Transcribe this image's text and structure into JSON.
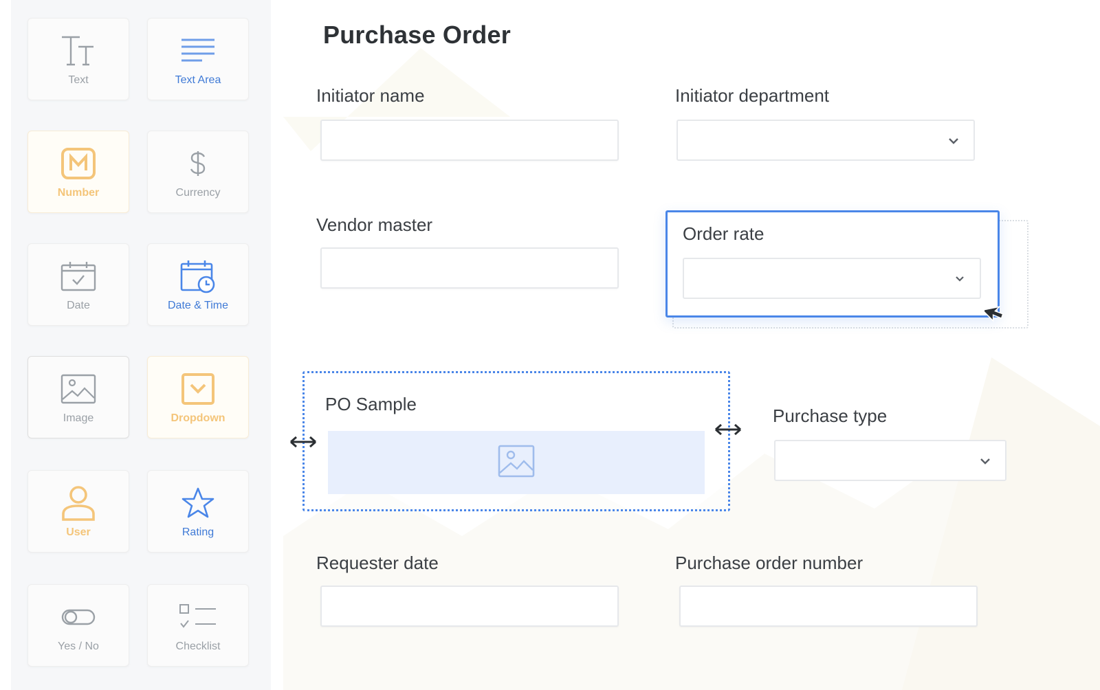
{
  "sidebar": {
    "items": [
      {
        "label": "Text",
        "icon": "text-type-icon"
      },
      {
        "label": "Text Area",
        "icon": "text-area-icon"
      },
      {
        "label": "Number",
        "icon": "number-icon"
      },
      {
        "label": "Currency",
        "icon": "dollar-icon"
      },
      {
        "label": "Date",
        "icon": "calendar-check-icon"
      },
      {
        "label": "Date & Time",
        "icon": "calendar-clock-icon"
      },
      {
        "label": "Image",
        "icon": "image-icon"
      },
      {
        "label": "Dropdown",
        "icon": "dropdown-icon"
      },
      {
        "label": "User",
        "icon": "user-icon"
      },
      {
        "label": "Rating",
        "icon": "star-icon"
      },
      {
        "label": "Yes / No",
        "icon": "toggle-icon"
      },
      {
        "label": "Checklist",
        "icon": "checklist-icon"
      }
    ]
  },
  "form": {
    "title": "Purchase Order",
    "fields": {
      "initiator_name": {
        "label": "Initiator name",
        "value": ""
      },
      "initiator_department": {
        "label": "Initiator department",
        "value": ""
      },
      "vendor_master": {
        "label": "Vendor master",
        "value": ""
      },
      "order_rate": {
        "label": "Order rate",
        "value": ""
      },
      "po_sample": {
        "label": "PO Sample"
      },
      "purchase_type": {
        "label": "Purchase type",
        "value": ""
      },
      "requester_date": {
        "label": "Requester date",
        "value": ""
      },
      "purchase_order_number": {
        "label": "Purchase order number",
        "value": ""
      }
    }
  },
  "colors": {
    "accent": "#4a86e8",
    "blue_label": "#3f7ad6",
    "orange_faded": "#f4c57a",
    "placeholder_bg": "#e8effd"
  }
}
